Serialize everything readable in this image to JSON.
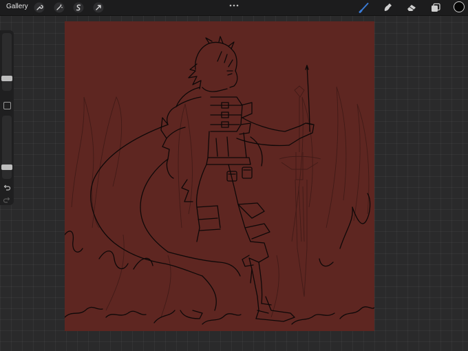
{
  "topbar": {
    "gallery_label": "Gallery",
    "left_tools": [
      "wrench-icon",
      "magic-wand-icon",
      "selection-icon",
      "transform-arrow-icon"
    ],
    "right_tools": [
      "brush-icon",
      "smudge-icon",
      "eraser-icon",
      "layers-icon"
    ],
    "active_tool": "brush-icon",
    "active_color": "#3a7bd5",
    "current_color": "#050505"
  },
  "sidebar": {
    "brush_size_level": 0.18,
    "opacity_level": 0.16
  },
  "canvas": {
    "background_color": "#5e2621",
    "line_color": "#0d0808"
  }
}
